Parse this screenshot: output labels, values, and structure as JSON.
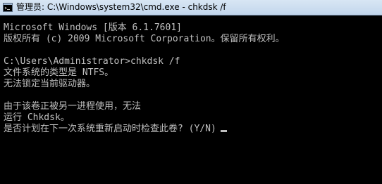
{
  "window": {
    "title": "管理员: C:\\Windows\\system32\\cmd.exe - chkdsk /f",
    "icon": "cmd-icon",
    "colors": {
      "console_background": "#000000",
      "console_text": "#c0c0c0",
      "titlebar": "#c9dbef"
    }
  },
  "console": {
    "lines": [
      "Microsoft Windows [版本 6.1.7601]",
      "版权所有 (c) 2009 Microsoft Corporation。保留所有权利。",
      "",
      "C:\\Users\\Administrator>chkdsk /f",
      "文件系统的类型是 NTFS。",
      "无法锁定当前驱动器。",
      "",
      "由于该卷正被另一进程使用，无法",
      "运行 Chkdsk。",
      "是否计划在下一次系统重新启动时检查此卷? (Y/N)"
    ]
  }
}
